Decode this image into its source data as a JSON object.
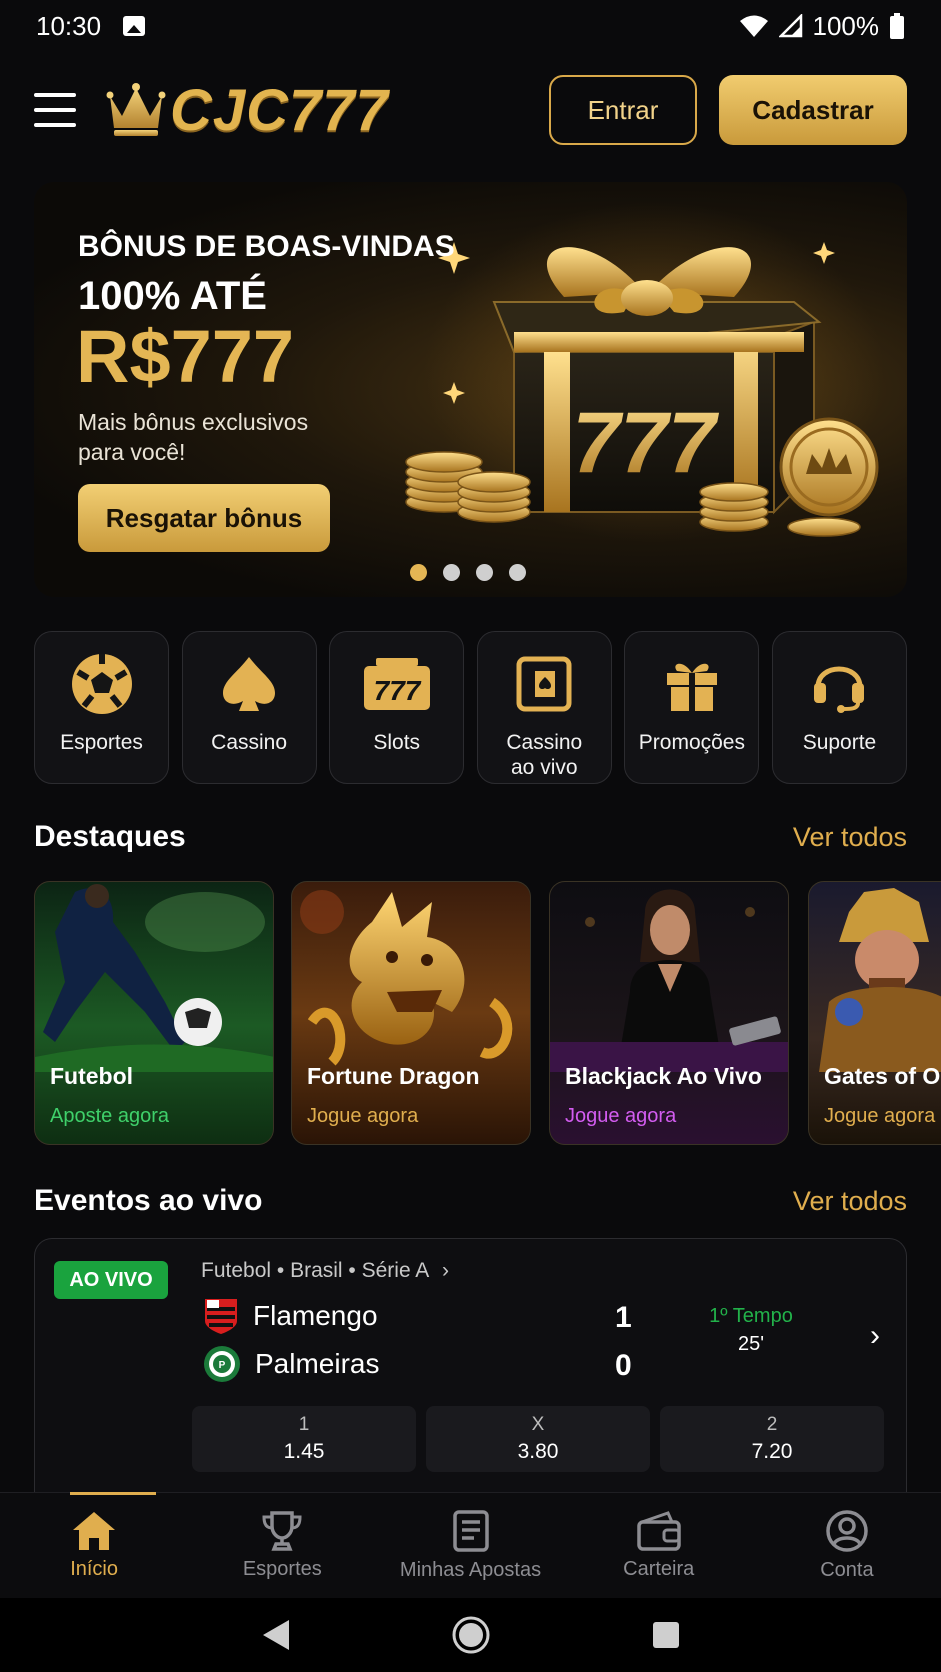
{
  "status_bar": {
    "time": "10:30",
    "battery": "100%"
  },
  "header": {
    "logo_text": "CJC777",
    "login_label": "Entrar",
    "register_label": "Cadastrar"
  },
  "banner": {
    "title": "BÔNUS DE BOAS-VINDAS",
    "subtitle": "100% ATÉ",
    "amount": "R$777",
    "description": "Mais bônus exclusivos para você!",
    "cta": "Resgatar bônus",
    "art_text": "777",
    "slides": 4,
    "active_slide": 1
  },
  "categories": [
    {
      "label": "Esportes",
      "icon": "soccer-ball-icon"
    },
    {
      "label": "Cassino",
      "icon": "spade-icon"
    },
    {
      "label": "Slots",
      "icon": "slot-777-icon"
    },
    {
      "label": "Cassino ao vivo",
      "icon": "live-cards-icon"
    },
    {
      "label": "Promoções",
      "icon": "gift-icon"
    },
    {
      "label": "Suporte",
      "icon": "headset-icon"
    }
  ],
  "highlights": {
    "title": "Destaques",
    "see_all": "Ver todos",
    "items": [
      {
        "name": "Futebol",
        "cta": "Aposte agora",
        "cta_color": "#3fd06a"
      },
      {
        "name": "Fortune Dragon",
        "cta": "Jogue agora",
        "cta_color": "#e0ae4e"
      },
      {
        "name": "Blackjack Ao Vivo",
        "cta": "Jogue agora",
        "cta_color": "#d35cf0"
      },
      {
        "name": "Gates of Olympus",
        "cta": "Jogue agora",
        "cta_color": "#e0ae4e"
      }
    ]
  },
  "live_events": {
    "title": "Eventos ao vivo",
    "see_all": "Ver todos",
    "event": {
      "badge": "AO VIVO",
      "league": "Futebol • Brasil • Série A",
      "home": "Flamengo",
      "away": "Palmeiras",
      "home_score": "1",
      "away_score": "0",
      "period": "1º Tempo",
      "minute": "25'",
      "odds": [
        {
          "label": "1",
          "value": "1.45"
        },
        {
          "label": "X",
          "value": "3.80"
        },
        {
          "label": "2",
          "value": "7.20"
        }
      ]
    }
  },
  "bottom_nav": [
    {
      "label": "Início",
      "icon": "home-icon",
      "active": true
    },
    {
      "label": "Esportes",
      "icon": "trophy-icon",
      "active": false
    },
    {
      "label": "Minhas Apostas",
      "icon": "betslip-icon",
      "active": false
    },
    {
      "label": "Carteira",
      "icon": "wallet-icon",
      "active": false
    },
    {
      "label": "Conta",
      "icon": "account-icon",
      "active": false
    }
  ],
  "colors": {
    "gold": "#e0ae4e",
    "live_green": "#1aa33e",
    "background": "#0a0a0c"
  }
}
